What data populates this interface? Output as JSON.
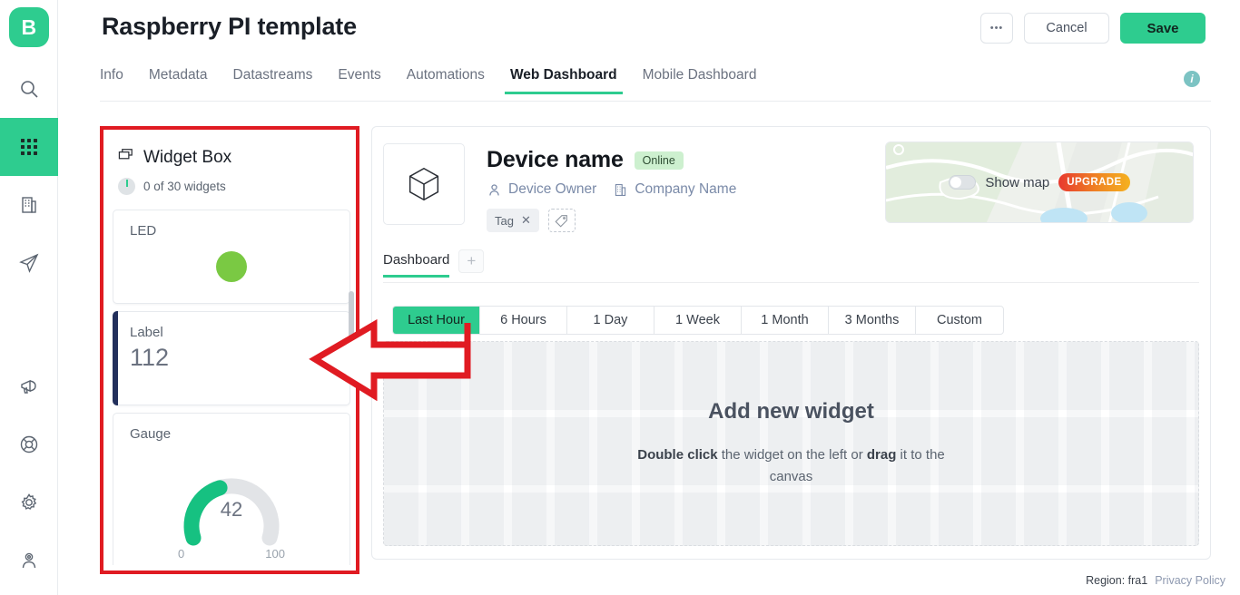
{
  "brand": {
    "logo_letter": "B",
    "accent": "#2ecc8f",
    "annotation_color": "#e01b22"
  },
  "rail": {
    "items": [
      {
        "name": "search-icon",
        "label": "Search"
      },
      {
        "name": "apps-grid-icon",
        "label": "Devices"
      },
      {
        "name": "building-icon",
        "label": "Companies"
      },
      {
        "name": "paper-plane-icon",
        "label": "Messages"
      },
      {
        "name": "megaphone-icon",
        "label": "Announcements"
      },
      {
        "name": "life-ring-icon",
        "label": "Support"
      },
      {
        "name": "gear-icon",
        "label": "Settings"
      },
      {
        "name": "user-icon",
        "label": "Account"
      }
    ]
  },
  "header": {
    "title": "Raspberry PI template",
    "more_label": "•••",
    "cancel_label": "Cancel",
    "save_label": "Save"
  },
  "tabs": {
    "items": [
      {
        "label": "Info",
        "active": false
      },
      {
        "label": "Metadata",
        "active": false
      },
      {
        "label": "Datastreams",
        "active": false
      },
      {
        "label": "Events",
        "active": false
      },
      {
        "label": "Automations",
        "active": false
      },
      {
        "label": "Web Dashboard",
        "active": true
      },
      {
        "label": "Mobile Dashboard",
        "active": false
      }
    ],
    "info_icon_label": "i"
  },
  "widget_box": {
    "title": "Widget Box",
    "counter": "0 of 30 widgets",
    "widgets": [
      {
        "type": "led",
        "title": "LED",
        "color": "#7ac943"
      },
      {
        "type": "label",
        "title": "Label",
        "value": "112",
        "accent": "#23305c"
      },
      {
        "type": "gauge",
        "title": "Gauge",
        "value": "42",
        "min": "0",
        "max": "100",
        "percent": 42,
        "color": "#16c181"
      }
    ]
  },
  "device": {
    "thumb_icon": "cube-icon",
    "name": "Device name",
    "status": "Online",
    "owner": "Device Owner",
    "company": "Company Name",
    "tags": [
      {
        "label": "Tag",
        "remove": "✕"
      }
    ],
    "add_tag_icon": "tag-icon",
    "map": {
      "show_label": "Show map",
      "toggle_on": false,
      "upgrade_label": "UPGRADE"
    }
  },
  "dashboard": {
    "tab_label": "Dashboard",
    "add_tab_label": "+",
    "ranges": [
      {
        "label": "Last Hour",
        "active": true
      },
      {
        "label": "6 Hours",
        "active": false
      },
      {
        "label": "1 Day",
        "active": false
      },
      {
        "label": "1 Week",
        "active": false
      },
      {
        "label": "1 Month",
        "active": false
      },
      {
        "label": "3 Months",
        "active": false
      },
      {
        "label": "Custom",
        "active": false
      }
    ],
    "empty_title": "Add new widget",
    "empty_hint_bold_1": "Double click",
    "empty_hint_mid": " the widget on the left or ",
    "empty_hint_bold_2": "drag",
    "empty_hint_end": " it to the canvas"
  },
  "footer": {
    "region": "Region: fra1",
    "privacy": "Privacy Policy"
  }
}
